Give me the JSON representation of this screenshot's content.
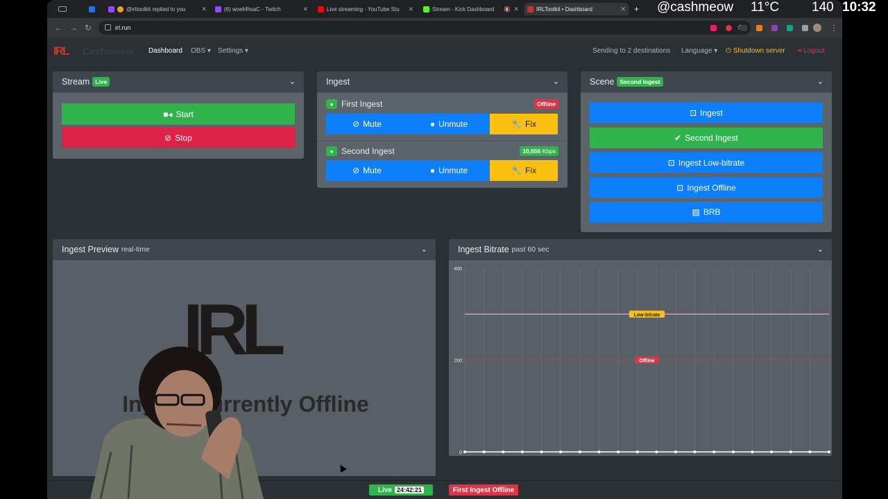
{
  "overlay": {
    "handle": "@cashmeow",
    "temp": "11°C",
    "number": "140",
    "clock": "10:32"
  },
  "browser": {
    "tabs": [
      {
        "label": "@irltoolkit replied to you",
        "color": "#9146ff"
      },
      {
        "label": "(6) woeMhsaC - Twitch",
        "color": "#9146ff"
      },
      {
        "label": "Live streaming - YouTube Stu",
        "color": "#ff0000"
      },
      {
        "label": "Stream - Kick Dashboard",
        "color": "#53fc18"
      },
      {
        "label": "IRLToolkit • Dashboard",
        "color": "#c0392b"
      }
    ],
    "url": "irl.run"
  },
  "navbar": {
    "brand": "Cashmeow",
    "logo": "IRL",
    "links": [
      "Dashboard",
      "OBS ▾",
      "Settings ▾"
    ],
    "destinations": "Sending to 2 destinations",
    "language": "Language ▾",
    "shutdown": "Shutdown server",
    "logout": "Logout"
  },
  "stream": {
    "title": "Stream",
    "badge": "Live",
    "start": "Start",
    "stop": "Stop"
  },
  "ingest": {
    "title": "Ingest",
    "rows": [
      {
        "name": "First Ingest",
        "status": "Offline",
        "status_color": "#dc3545"
      },
      {
        "name": "Second Ingest",
        "status": "10,656",
        "unit": "Kbps",
        "status_color": "#2fb44b"
      }
    ],
    "mute": "Mute",
    "unmute": "Unmute",
    "fix": "Fix"
  },
  "scene": {
    "title": "Scene",
    "badge": "Second Ingest",
    "buttons": [
      {
        "label": "Ingest",
        "active": false
      },
      {
        "label": "Second Ingest",
        "active": true
      },
      {
        "label": "Ingest Low-bitrate",
        "active": false
      },
      {
        "label": "Ingest Offline",
        "active": false
      },
      {
        "label": "BRB",
        "active": false
      }
    ]
  },
  "preview": {
    "title": "Ingest Preview",
    "subtitle": "real-time",
    "logo": "IRL",
    "caption": "Ingest Currently Offline"
  },
  "bitrate": {
    "title": "Ingest Bitrate",
    "subtitle": "past 60 sec"
  },
  "chart_data": {
    "type": "line",
    "title": "Ingest Bitrate",
    "subtitle": "past 60 sec",
    "y_ticks": [
      0,
      200,
      400
    ],
    "ylim": [
      0,
      400
    ],
    "thresholds": [
      {
        "label": "Low-bitrate",
        "value": 300,
        "color": "#fbc010",
        "line": "#f4a9a9"
      },
      {
        "label": "Offline",
        "value": 200,
        "color": "#dc3545",
        "line": "#dc3545"
      }
    ],
    "series": [
      {
        "values": [
          0,
          0,
          0,
          0,
          0,
          0,
          0,
          0,
          0,
          0,
          0,
          0,
          0,
          0,
          0,
          0,
          0,
          0,
          0,
          0
        ]
      }
    ],
    "grid": true
  },
  "statusbar": {
    "live": "Live",
    "timer": "24:42:21",
    "alert": "First Ingest Offline"
  }
}
